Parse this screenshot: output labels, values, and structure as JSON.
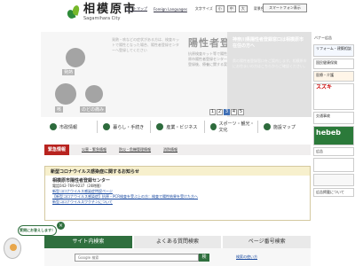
{
  "header": {
    "logo_jp": "相模原市",
    "logo_en": "Sagamihara City",
    "util_links": [
      "サイトマップ",
      "Foreign Languages"
    ],
    "font_label": "文字サイズ",
    "font_buttons": [
      "小",
      "中",
      "大"
    ],
    "color_label": "背景色",
    "color_buttons": [
      "白",
      "黒",
      "青"
    ],
    "sp_label": "スマートフォン表示"
  },
  "hero": {
    "captions": [
      "発熱",
      "咳",
      "のどの痛み"
    ],
    "title": "陽性者登録のお願い",
    "left_text": "発熱・咳などの症状がある方は、検査キットで陽性となった場合、陽性者登録センターへ登録してください",
    "body": "抗原検査キット等で陽性となった方は、相模原市陽性者登録センターにご登録ください。登録後、療養に関する案内をお送りします。",
    "side_title": "神奈川県陽性者登録窓口は相模原市在住の方へ",
    "side_body": "県の陽性者登録窓口をご案内します。相模原市にお住まいの方はこちらからご確認ください。",
    "slider_pages": [
      "1",
      "2",
      "3",
      "4",
      "5"
    ]
  },
  "nav": {
    "items": [
      "市政情報",
      "暮らし・手続き",
      "産業・ビジネス",
      "スポーツ・観光・文化",
      "施設マップ"
    ]
  },
  "emergency": {
    "label": "緊急情報",
    "links": [
      "災害・緊急情報",
      "防災・危機管理情報",
      "消防情報"
    ]
  },
  "notice": {
    "heading": "新型コロナウイルス感染症に関するお知らせ",
    "center_title": "相模原市陽性者登録センター",
    "phone": "電話042-769-9237（24時間）",
    "links": [
      "新型コロナウイルス感染症特設ページ",
      "【新型コロナウイルス感染症】抗原・PCR検査を受ぶ上の方：検査で陽性結果を受けた方へ",
      "新型コロナウイルスワクチンについて"
    ]
  },
  "search": {
    "tabs": [
      "サイト内検索",
      "よくある質問検索",
      "ページ番号検索"
    ],
    "placeholder": "Google 検索",
    "button": "検",
    "help": "検索の使い方"
  },
  "chat": {
    "bubble": "質問にお答えします！",
    "close": "×"
  },
  "ads": {
    "title": "バナー広告",
    "items": [
      "リフォーム・建築相談",
      "国民健康保険",
      "医療・介護",
      "スズキ",
      "交通事故",
      "hebeb",
      "広告",
      "",
      "",
      "広告掲載について"
    ]
  }
}
